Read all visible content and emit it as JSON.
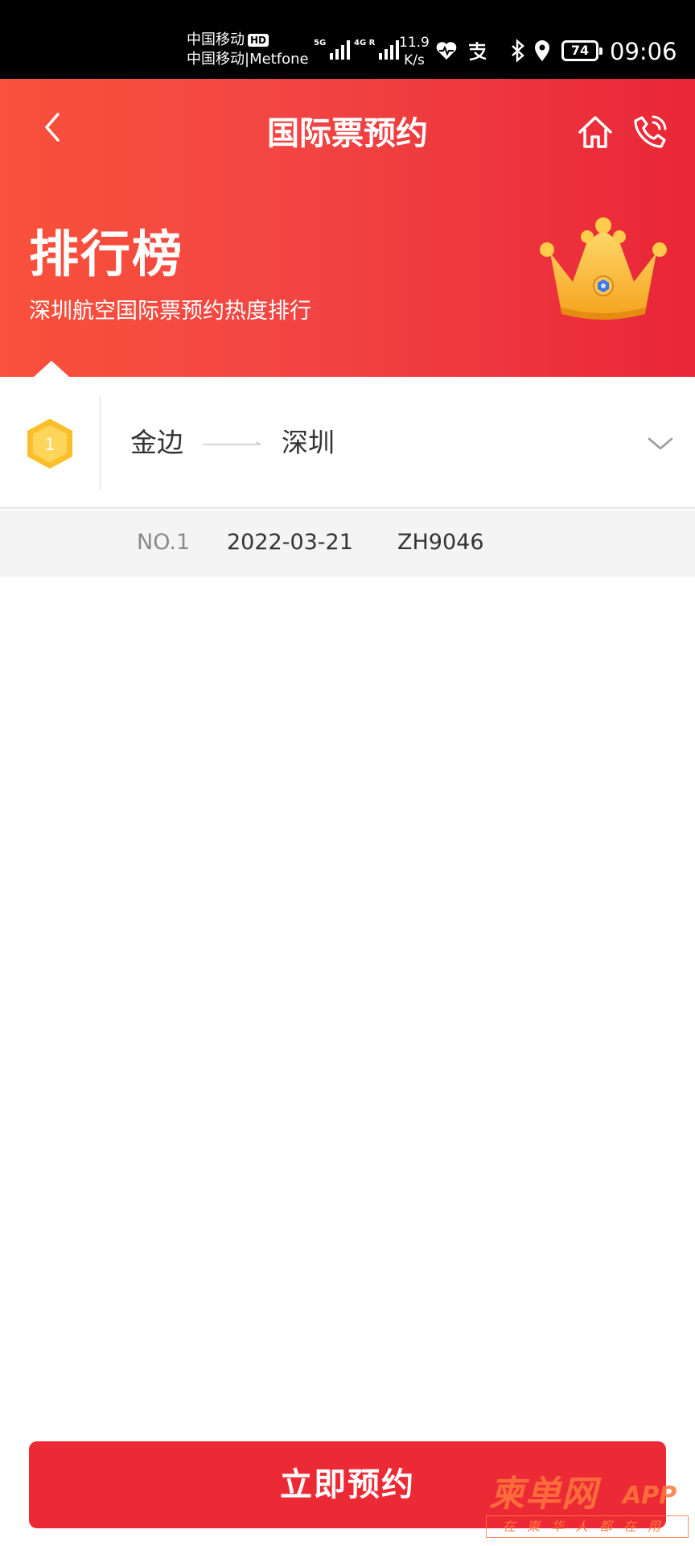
{
  "status_bar": {
    "carrier_1": "中国移动",
    "hd": "HD",
    "carrier_2": "中国移动|Metfone",
    "net_1": "5G",
    "net_2": "4G R",
    "speed_value": "11.9",
    "speed_unit": "K/s",
    "battery": "74",
    "time": "09:06",
    "icons": [
      "heart-rate-icon",
      "alipay-icon",
      "bluetooth-icon",
      "location-icon"
    ]
  },
  "header": {
    "title": "国际票预约",
    "back_icon": "chevron-left-icon",
    "home_icon": "home-icon",
    "phone_icon": "phone-icon"
  },
  "banner": {
    "title": "排行榜",
    "subtitle": "深圳航空国际票预约热度排行",
    "image": "crown"
  },
  "ranking": [
    {
      "rank": "1",
      "from": "金边",
      "to": "深圳",
      "expanded": true,
      "details": {
        "no": "NO.1",
        "date": "2022-03-21",
        "flight": "ZH9046"
      }
    }
  ],
  "footer": {
    "reserve_label": "立即预约"
  },
  "watermark": {
    "main": "柬单网",
    "app": "APP",
    "sub": "在柬华人都在用"
  },
  "colors": {
    "brand_red": "#ec2a36",
    "banner_start": "#f9513b",
    "banner_end": "#e92637",
    "badge_gold": "#fbbf2c"
  }
}
